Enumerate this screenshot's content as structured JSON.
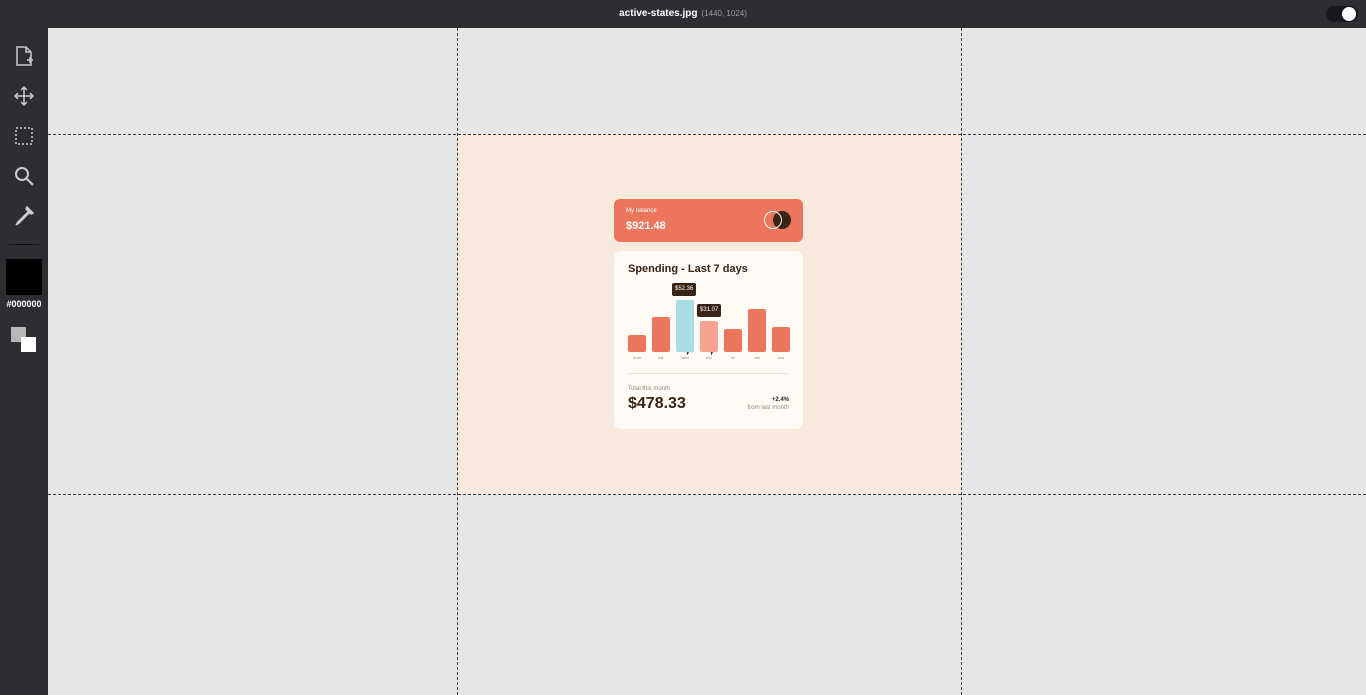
{
  "app": {
    "filename": "active-states.jpg",
    "dimensions": "(1440, 1024)",
    "toggle_on": true
  },
  "toolbar": {
    "tools": [
      "new-file-icon",
      "move-icon",
      "marquee-select-icon",
      "zoom-icon",
      "eyedropper-icon"
    ],
    "color_hex": "#000000",
    "foreground_color": "#b7b7b7",
    "background_color": "#ffffff"
  },
  "card": {
    "balance_label": "My balance",
    "balance_amount": "$921.48",
    "title": "Spending - Last 7 days",
    "tooltips": {
      "wed": "$52.36",
      "thu": "$31.07"
    },
    "days": [
      "mon",
      "tue",
      "wed",
      "thu",
      "fri",
      "sat",
      "sun"
    ],
    "total_label": "Total this month",
    "total_amount": "$478.33",
    "change": "+2.4%",
    "change_label": "from last month"
  },
  "colors": {
    "app_chrome": "#2c2e31",
    "canvas": "#e6e6e6",
    "artboard": "#f8e9dd",
    "soft_red": "#ec755d",
    "cyan_active": "#a8dde6",
    "hover_red": "#f6a491",
    "dark_brown": "#382314",
    "card_bg": "#fffaf5"
  },
  "chart_data": {
    "type": "bar",
    "categories": [
      "mon",
      "tue",
      "wed",
      "thu",
      "fri",
      "sat",
      "sun"
    ],
    "values": [
      17.45,
      34.91,
      52.36,
      31.07,
      23.39,
      43.28,
      25.48
    ]
  }
}
